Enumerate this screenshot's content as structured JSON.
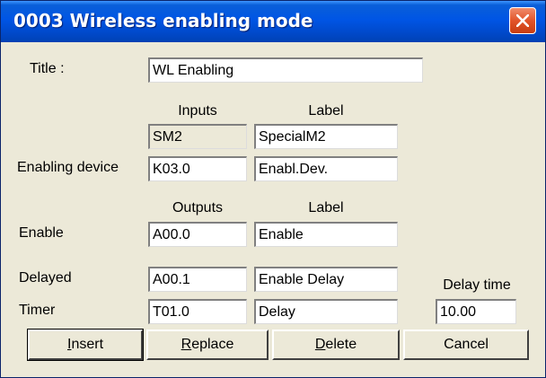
{
  "window": {
    "title": "0003  Wireless enabling mode"
  },
  "form": {
    "title_label": "Title :",
    "title_value": "WL Enabling",
    "inputs_header": "Inputs",
    "inputs_label_header": "Label",
    "sm2_input": "SM2",
    "sm2_label": "SpecialM2",
    "enabling_device_label": "Enabling device",
    "enabling_device_input": "K03.0",
    "enabling_device_tag": "Enabl.Dev.",
    "outputs_header": "Outputs",
    "outputs_label_header": "Label",
    "enable_label": "Enable",
    "enable_output": "A00.0",
    "enable_tag": "Enable",
    "delayed_label": "Delayed",
    "delayed_output": "A00.1",
    "delayed_tag": "Enable Delay",
    "delay_time_label": "Delay time",
    "timer_label": "Timer",
    "timer_output": "T01.0",
    "timer_tag": "Delay",
    "delay_time_value": "10.00"
  },
  "buttons": {
    "insert": {
      "mnemonic": "I",
      "rest": "nsert"
    },
    "replace": {
      "mnemonic": "R",
      "rest": "eplace"
    },
    "delete": {
      "mnemonic": "D",
      "rest": "elete"
    },
    "cancel": "Cancel"
  }
}
